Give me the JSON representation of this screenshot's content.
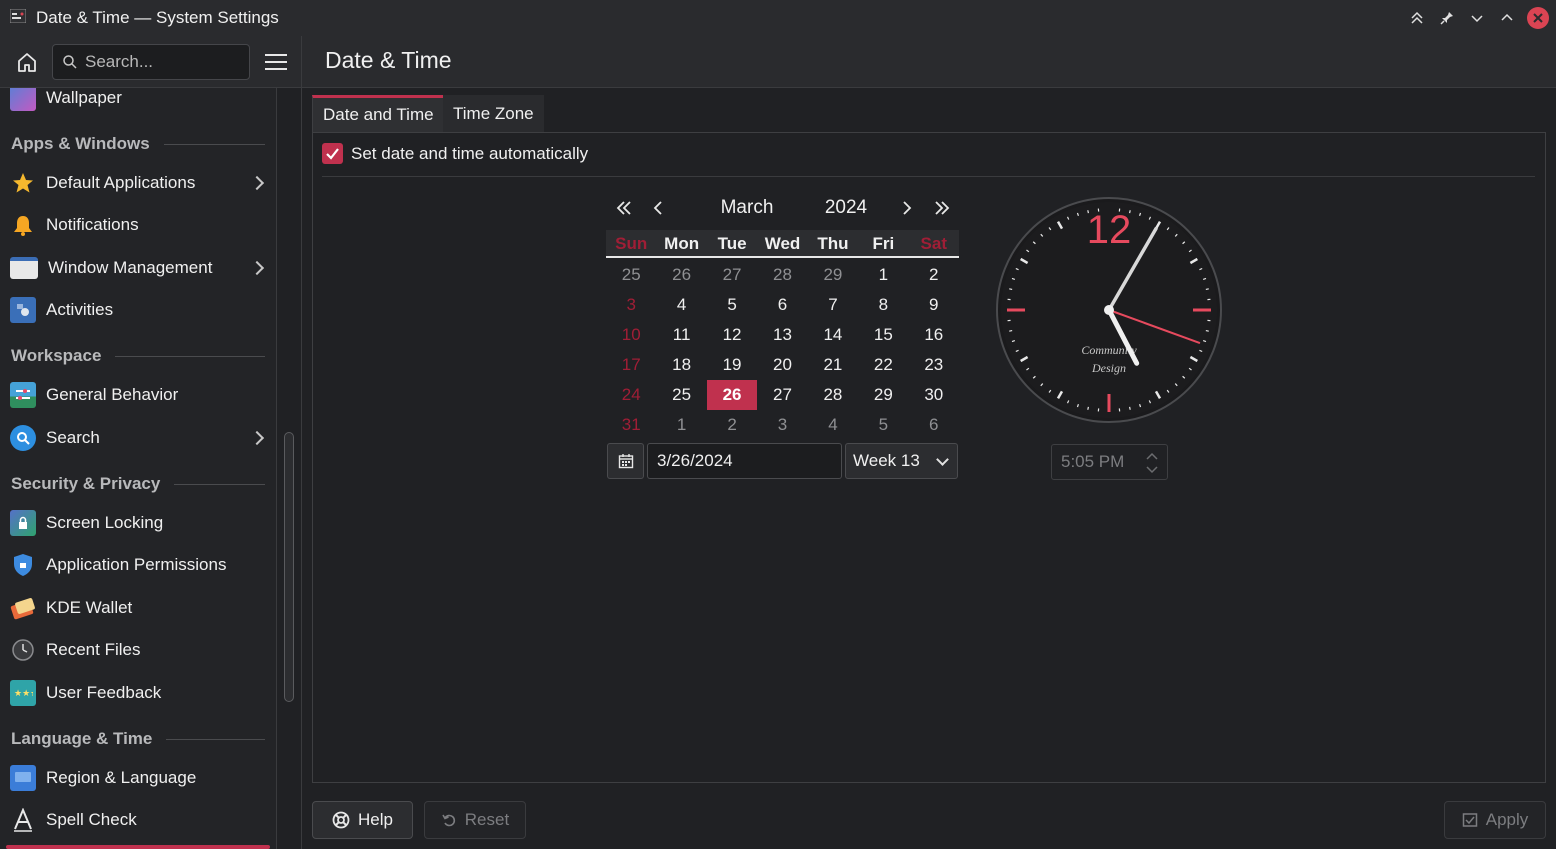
{
  "window": {
    "title": "Date & Time — System Settings"
  },
  "header": {
    "search_placeholder": "Search...",
    "page_title": "Date & Time"
  },
  "sidebar": {
    "top_item": "Wallpaper",
    "sections": [
      {
        "title": "Apps & Windows"
      },
      {
        "title": "Workspace"
      },
      {
        "title": "Security & Privacy"
      },
      {
        "title": "Language & Time"
      }
    ],
    "items": [
      {
        "label": "Default Applications",
        "icon": "star-icon"
      },
      {
        "label": "Notifications",
        "icon": "bell-icon"
      },
      {
        "label": "Window Management",
        "icon": "window-icon"
      },
      {
        "label": "Activities",
        "icon": "activities-icon"
      },
      {
        "label": "General Behavior",
        "icon": "general-behavior-icon"
      },
      {
        "label": "Search",
        "icon": "search-icon"
      },
      {
        "label": "Screen Locking",
        "icon": "screen-lock-icon"
      },
      {
        "label": "Application Permissions",
        "icon": "shield-icon"
      },
      {
        "label": "KDE Wallet",
        "icon": "wallet-icon"
      },
      {
        "label": "Recent Files",
        "icon": "clock-icon"
      },
      {
        "label": "User Feedback",
        "icon": "feedback-icon"
      },
      {
        "label": "Region & Language",
        "icon": "region-icon"
      },
      {
        "label": "Spell Check",
        "icon": "spell-check-icon"
      }
    ]
  },
  "tabs": [
    {
      "label": "Date and Time",
      "active": true
    },
    {
      "label": "Time Zone",
      "active": false
    }
  ],
  "auto_time": {
    "label": "Set date and time automatically",
    "checked": true
  },
  "calendar": {
    "month": "March",
    "year": "2024",
    "weekdays": [
      "Sun",
      "Mon",
      "Tue",
      "Wed",
      "Thu",
      "Fri",
      "Sat"
    ],
    "weeks": [
      [
        "25",
        "26",
        "27",
        "28",
        "29",
        "1",
        "2"
      ],
      [
        "3",
        "4",
        "5",
        "6",
        "7",
        "8",
        "9"
      ],
      [
        "10",
        "11",
        "12",
        "13",
        "14",
        "15",
        "16"
      ],
      [
        "17",
        "18",
        "19",
        "20",
        "21",
        "22",
        "23"
      ],
      [
        "24",
        "25",
        "26",
        "27",
        "28",
        "29",
        "30"
      ],
      [
        "31",
        "1",
        "2",
        "3",
        "4",
        "5",
        "6"
      ]
    ],
    "selected_day": "26",
    "date_value": "3/26/2024",
    "week_label": "Week 13"
  },
  "clock": {
    "numeral": "12",
    "brand_line1": "Community",
    "brand_line2": "Design",
    "hour": 5,
    "minute": 5,
    "second": 10,
    "time_value": "5:05 PM"
  },
  "buttons": {
    "help": "Help",
    "reset": "Reset",
    "apply": "Apply"
  },
  "colors": {
    "accent": "#c0314e",
    "background": "#202124",
    "sidebar": "#232427"
  }
}
